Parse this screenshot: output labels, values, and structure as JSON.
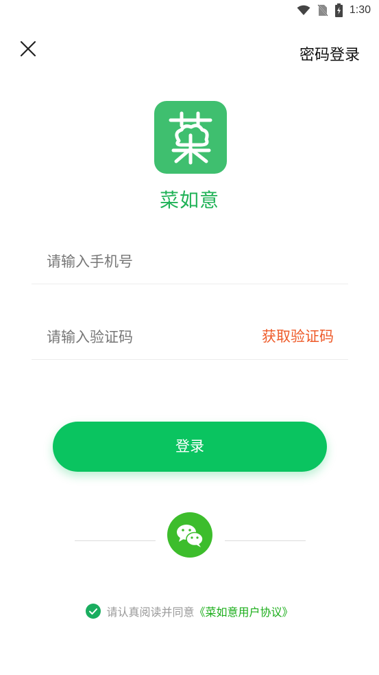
{
  "status_bar": {
    "time": "1:30"
  },
  "header": {
    "close_icon": "close-icon",
    "password_login_label": "密码登录"
  },
  "app": {
    "logo_text": "菜",
    "name": "菜如意",
    "brand_color": "#3fbf6f"
  },
  "form": {
    "phone_placeholder": "请输入手机号",
    "phone_value": "",
    "code_placeholder": "请输入验证码",
    "code_value": "",
    "get_code_label": "获取验证码"
  },
  "login_button_label": "登录",
  "third_party": {
    "wechat_icon": "wechat-icon"
  },
  "agreement": {
    "text": "请认真阅读并同意",
    "link": "《菜如意用户协议》",
    "checked": true
  },
  "colors": {
    "primary": "#0ac460",
    "accent": "#ee5b2a",
    "link": "#1aad19"
  }
}
